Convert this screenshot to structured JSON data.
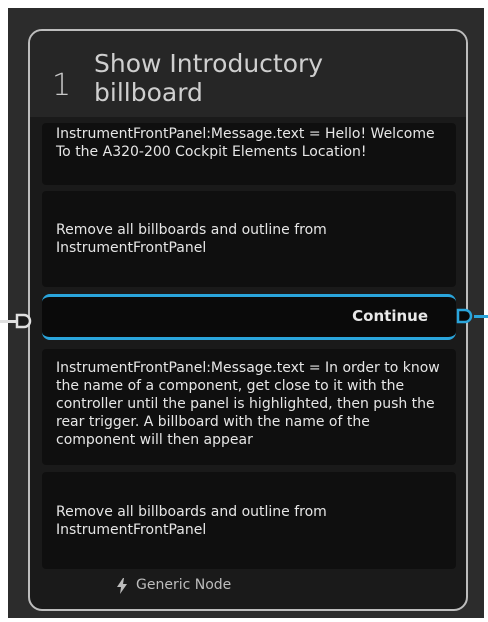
{
  "node": {
    "number": "1",
    "title_line1": "Show Introductory",
    "title_line2": "billboard",
    "blocks": [
      {
        "text": "InstrumentFrontPanel:Message.text = Hello! Welcome To the A320-200 Cockpit Elements Location!"
      },
      {
        "text": "Remove all billboards and outline from InstrumentFrontPanel"
      },
      {
        "text": "InstrumentFrontPanel:Message.text = In order to know the name of a component, get close to it with the controller until the panel is highlighted, then push the rear trigger. A billboard with the name of the component will then appear"
      },
      {
        "text": "Remove all billboards and outline from InstrumentFrontPanel"
      }
    ],
    "continue_label": "Continue",
    "footer_label": "Generic Node",
    "footer_icon": "lightning-icon"
  },
  "colors": {
    "accent": "#2aa5dc",
    "node_border": "#bdbdbd",
    "background": "#2c2c2c"
  }
}
